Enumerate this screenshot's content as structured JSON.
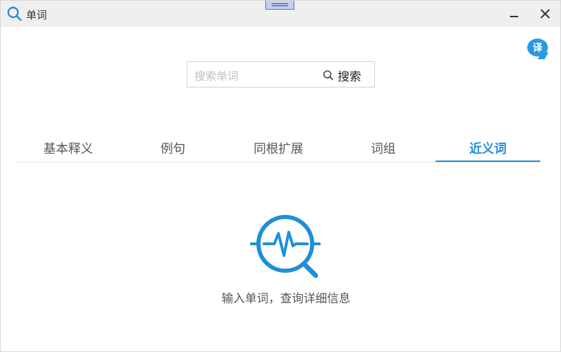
{
  "window": {
    "title": "单词"
  },
  "translate_button": {
    "label": "译"
  },
  "search": {
    "placeholder": "搜索单词",
    "value": "",
    "button_label": "搜索"
  },
  "tabs": [
    {
      "label": "基本释义",
      "active": false
    },
    {
      "label": "例句",
      "active": false
    },
    {
      "label": "同根扩展",
      "active": false
    },
    {
      "label": "词组",
      "active": false
    },
    {
      "label": "近义词",
      "active": true
    }
  ],
  "empty_state": {
    "icon": "search-pulse-icon",
    "message": "输入单词，查询详细信息"
  },
  "colors": {
    "accent": "#1e8fd8",
    "titlebar": "#efefef"
  }
}
